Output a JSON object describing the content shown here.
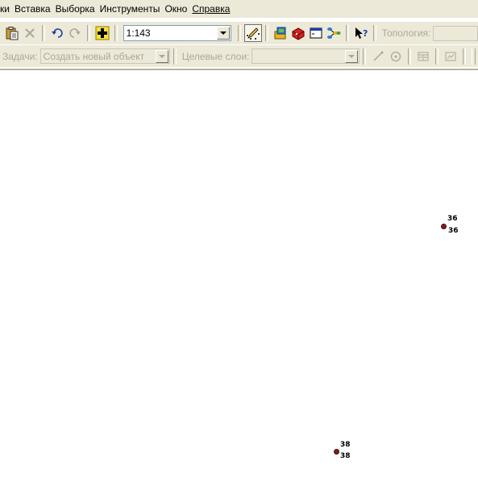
{
  "menu": {
    "items": [
      {
        "label": "ки"
      },
      {
        "label": "Вставка"
      },
      {
        "label": "Выборка"
      },
      {
        "label": "Инструменты"
      },
      {
        "label": "Окно"
      },
      {
        "label": "Справка"
      }
    ]
  },
  "toolbar1": {
    "scale_value": "1:143",
    "topology_label": "Топология:",
    "icons": [
      "paste-icon",
      "delete-icon",
      "undo-icon",
      "redo-icon",
      "add-data-icon",
      "editor-toolbar-icon",
      "arccatalog-icon",
      "arctoolbox-icon",
      "command-line-icon",
      "model-builder-icon",
      "whats-this-icon"
    ]
  },
  "toolbar2": {
    "task_label": "Задачи:",
    "task_value": "Создать новый объект",
    "target_label": "Целевые слои:",
    "target_value": ""
  },
  "map": {
    "points": [
      {
        "label_top": "36",
        "label_bottom": "36"
      },
      {
        "label_top": "38",
        "label_bottom": "38"
      }
    ]
  },
  "colors": {
    "chrome": "#ece9d8",
    "point": "#8b1a1a",
    "disabled_text": "#aca899"
  }
}
